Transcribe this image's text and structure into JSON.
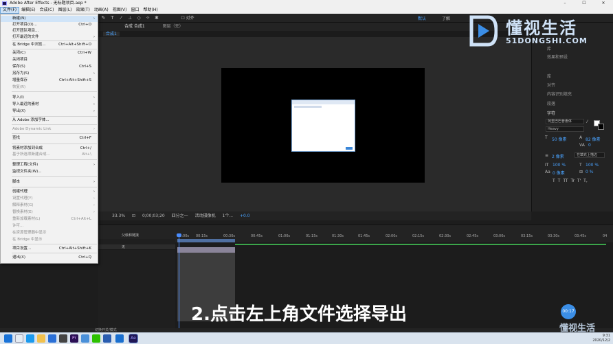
{
  "window": {
    "title": "Adobe After Effects - 无标题项目.aep *",
    "controls": [
      "–",
      "☐",
      "✕"
    ]
  },
  "menubar": [
    "文件(F)",
    "编辑(E)",
    "合成(C)",
    "图层(L)",
    "效果(T)",
    "动画(A)",
    "视图(V)",
    "窗口",
    "帮助(H)"
  ],
  "toolbar": {
    "snap_label": "对齐",
    "workspace": "默认",
    "learn": "了解",
    "search_hint": "⌕"
  },
  "file_menu": {
    "items": [
      {
        "label": "新建(N)",
        "shortcut": "",
        "arrow": true,
        "disabled": false
      },
      {
        "label": "打开项目(O)...",
        "shortcut": "Ctrl+O",
        "arrow": false,
        "disabled": false
      },
      {
        "label": "打开团队项目...",
        "shortcut": "",
        "arrow": false,
        "disabled": false
      },
      {
        "label": "打开最近的文件",
        "shortcut": "",
        "arrow": true,
        "disabled": false
      },
      {
        "label": "在 Bridge 中浏览...",
        "shortcut": "Ctrl+Alt+Shift+O",
        "arrow": false,
        "disabled": false
      },
      {
        "label": "关闭(C)",
        "shortcut": "Ctrl+W",
        "arrow": false,
        "disabled": false
      },
      {
        "label": "关闭项目",
        "shortcut": "",
        "arrow": false,
        "disabled": false
      },
      {
        "label": "保存(S)",
        "shortcut": "Ctrl+S",
        "arrow": false,
        "disabled": false
      },
      {
        "label": "另存为(S)",
        "shortcut": "",
        "arrow": true,
        "disabled": false
      },
      {
        "label": "增量保存",
        "shortcut": "Ctrl+Alt+Shift+S",
        "arrow": false,
        "disabled": false
      },
      {
        "label": "恢复(R)",
        "shortcut": "",
        "arrow": false,
        "disabled": true
      },
      {
        "label": "导入(I)",
        "shortcut": "",
        "arrow": true,
        "disabled": false
      },
      {
        "label": "导入最近的素材",
        "shortcut": "",
        "arrow": true,
        "disabled": false
      },
      {
        "label": "导出(X)",
        "shortcut": "",
        "arrow": true,
        "disabled": false
      },
      {
        "label": "从 Adobe 添加字体...",
        "shortcut": "",
        "arrow": false,
        "disabled": false
      },
      {
        "label": "Adobe Dynamic Link",
        "shortcut": "",
        "arrow": true,
        "disabled": true
      },
      {
        "label": "查找",
        "shortcut": "Ctrl+F",
        "arrow": false,
        "disabled": false
      },
      {
        "label": "将素材添加到合成",
        "shortcut": "Ctrl+/",
        "arrow": false,
        "disabled": false
      },
      {
        "label": "基于所选项新建合成...",
        "shortcut": "Alt+\\",
        "arrow": false,
        "disabled": true
      },
      {
        "label": "整理工程(文件)",
        "shortcut": "",
        "arrow": true,
        "disabled": false
      },
      {
        "label": "监视文件夹(W)...",
        "shortcut": "",
        "arrow": false,
        "disabled": false
      },
      {
        "label": "脚本",
        "shortcut": "",
        "arrow": true,
        "disabled": false
      },
      {
        "label": "创建代理",
        "shortcut": "",
        "arrow": true,
        "disabled": false
      },
      {
        "label": "设置代理(Y)",
        "shortcut": "",
        "arrow": true,
        "disabled": true
      },
      {
        "label": "解释素材(G)",
        "shortcut": "",
        "arrow": true,
        "disabled": true
      },
      {
        "label": "替换素材(E)",
        "shortcut": "",
        "arrow": true,
        "disabled": true
      },
      {
        "label": "重新加载素材(L)",
        "shortcut": "Ctrl+Alt+L",
        "arrow": false,
        "disabled": true
      },
      {
        "label": "许可...",
        "shortcut": "",
        "arrow": false,
        "disabled": true
      },
      {
        "label": "在资源管理器中显示",
        "shortcut": "",
        "arrow": false,
        "disabled": true
      },
      {
        "label": "在 Bridge 中显示",
        "shortcut": "",
        "arrow": false,
        "disabled": true
      },
      {
        "label": "项目设置...",
        "shortcut": "Ctrl+Alt+Shift+K",
        "arrow": false,
        "disabled": false
      },
      {
        "label": "退出(X)",
        "shortcut": "Ctrl+Q",
        "arrow": false,
        "disabled": false
      }
    ]
  },
  "composition": {
    "tab_label": "合成 合成1",
    "layer_tab": "图层（无）",
    "sub_tab": "合成1"
  },
  "viewer_controls": {
    "zoom": "33.3%",
    "timecode": "0;00;03;20",
    "resolution": "四分之一",
    "camera": "活动摄像机",
    "views": "1个...",
    "exposure": "+0.0"
  },
  "right_panel": {
    "items": [
      "库",
      "效果和预设",
      "库",
      "对齐",
      "内容识别填充",
      "段落",
      "字符"
    ],
    "font_family": "阿里巴巴普惠体",
    "font_style": "Heavy",
    "font_size": "50 像素",
    "leading": "82 像素",
    "tracking": "0",
    "stroke_width": "2 像素",
    "stroke_mode": "在填充上描边",
    "vscale": "100 %",
    "hscale": "100 %",
    "baseline": "0 像素",
    "tsume": "0 %",
    "styles": [
      "T",
      "T",
      "TT",
      "Tr",
      "T'",
      "T,"
    ]
  },
  "logo": {
    "big_text": "懂视生活",
    "small_text": "51DONGSHI.COM",
    "accent": "#3b8ee6"
  },
  "timeline": {
    "ruler": [
      "00:00s",
      "00:15s",
      "00:30s",
      "00:45s",
      "01:00s",
      "01:15s",
      "01:30s",
      "01:45s",
      "02:00s",
      "02:15s",
      "02:30s",
      "02:45s",
      "03:00s",
      "03:15s",
      "03:30s",
      "03:45s",
      "04"
    ],
    "col_header": "父级和链接",
    "layer_parent": "无",
    "toggle_label": "切换开关/模式"
  },
  "subtitle": "2.点击左上角文件选择导出",
  "bubble_time": "00:17",
  "taskbar": {
    "time": "9:31",
    "date": "2020/12/2",
    "apps": [
      "win",
      "search",
      "task",
      "explorer",
      "edge",
      "files",
      "pr",
      "photos",
      "chat",
      "ps",
      "ae"
    ]
  },
  "watermark": "懂视生活"
}
